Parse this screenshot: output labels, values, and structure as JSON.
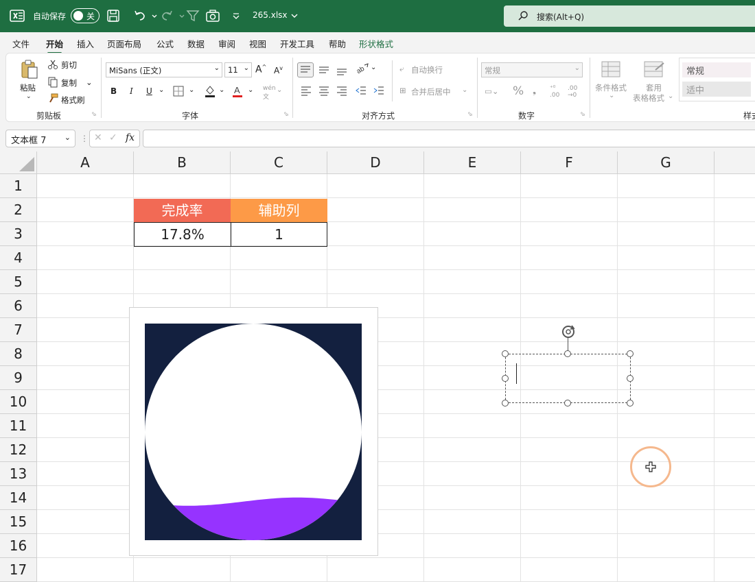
{
  "titlebar": {
    "autosave_label": "自动保存",
    "toggle_state": "关",
    "filename": "265.xlsx",
    "search_text": "搜索(Alt+Q)",
    "bg_color": "#1e6e41"
  },
  "menu": {
    "tabs": [
      "文件",
      "开始",
      "插入",
      "页面布局",
      "公式",
      "数据",
      "审阅",
      "视图",
      "开发工具",
      "帮助",
      "形状格式"
    ],
    "active": "开始"
  },
  "ribbon": {
    "clipboard": {
      "paste": "粘贴",
      "cut": "剪切",
      "copy": "复制",
      "format_painter": "格式刷",
      "label": "剪贴板"
    },
    "font": {
      "name": "MiSans (正文)",
      "size": "11",
      "bold": "B",
      "italic": "I",
      "underline": "U",
      "label": "字体"
    },
    "alignment": {
      "wrap": "自动换行",
      "merge": "合并后居中",
      "label": "对齐方式"
    },
    "number": {
      "format": "常规",
      "percent": "%",
      "label": "数字"
    },
    "styles": {
      "conditional": "条件格式",
      "table_format_1": "套用",
      "table_format_2": "表格格式",
      "style_normal": "常规",
      "style_neutral": "适中",
      "label": "样式"
    }
  },
  "formula_bar": {
    "name_box": "文本框 7",
    "fx": "fx",
    "formula": ""
  },
  "sheet": {
    "columns": [
      "A",
      "B",
      "C",
      "D",
      "E",
      "F",
      "G"
    ],
    "rows": [
      "1",
      "2",
      "3",
      "4",
      "5",
      "6",
      "7",
      "8",
      "9",
      "10",
      "11",
      "12",
      "13",
      "14",
      "15",
      "16",
      "17"
    ],
    "cells": {
      "B2": "完成率",
      "C2": "辅助列",
      "B3": "17.8%",
      "C3": "1"
    },
    "colors": {
      "header_b": "#f26a55",
      "header_c": "#fd9a47"
    }
  },
  "chart_data": {
    "type": "area",
    "completion_rate": 0.178,
    "fill_color": "#9633ff",
    "background_color": "#13203f",
    "circle_color": "#ffffff"
  }
}
